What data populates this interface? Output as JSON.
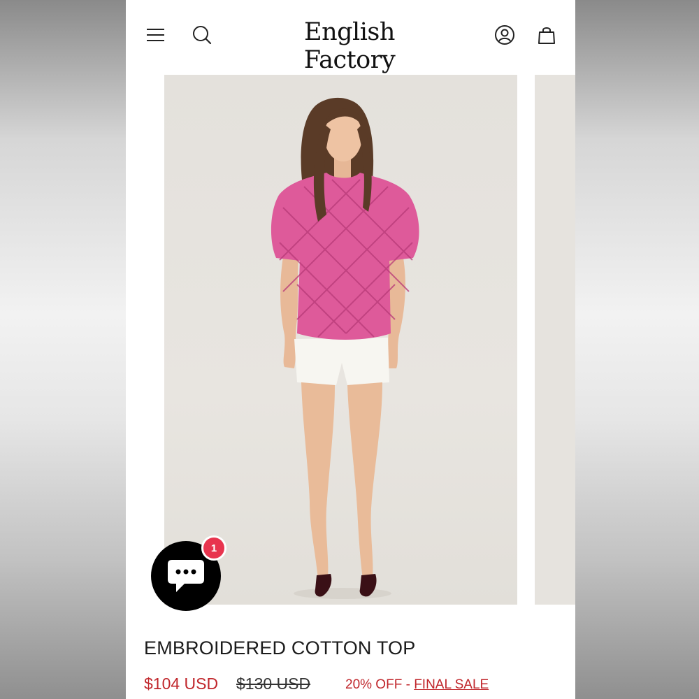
{
  "header": {
    "brand": "English Factory",
    "menu_icon": "hamburger-menu-icon",
    "search_icon": "search-icon",
    "account_icon": "account-icon",
    "cart_icon": "shopping-bag-icon"
  },
  "gallery": {
    "main_image": "product-photo",
    "next_image": "product-photo-next"
  },
  "chat": {
    "icon": "chat-bubble-icon",
    "badge_count": "1"
  },
  "product": {
    "title": "EMBROIDERED COTTON TOP",
    "price": "$104 USD",
    "compare_price": "$130 USD",
    "discount_text": "20% OFF - ",
    "final_sale": "FINAL SALE"
  },
  "colors": {
    "sale_red": "#c0262b",
    "badge_red": "#e8344e",
    "top_pink": "#de5a9a"
  }
}
